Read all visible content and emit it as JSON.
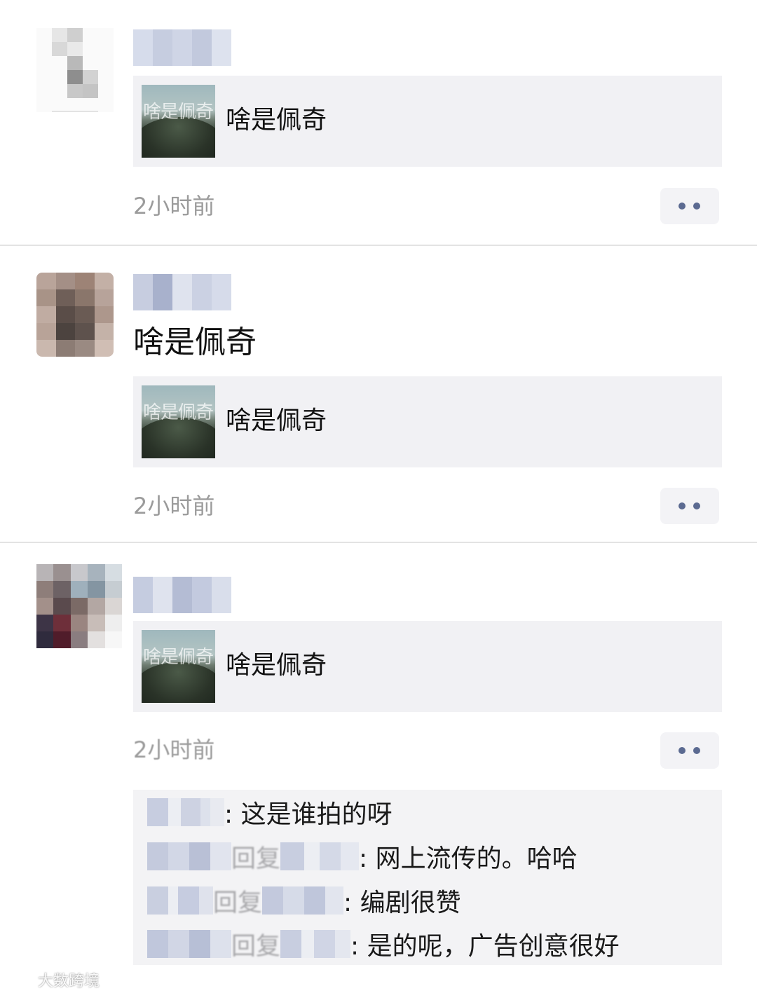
{
  "posts": [
    {
      "text": "",
      "share": {
        "title": "啥是佩奇",
        "thumb_text": "啥是佩奇"
      },
      "time": "2小时前"
    },
    {
      "text": "啥是佩奇",
      "share": {
        "title": "啥是佩奇",
        "thumb_text": "啥是佩奇"
      },
      "time": "2小时前"
    },
    {
      "text": "",
      "share": {
        "title": "啥是佩奇",
        "thumb_text": "啥是佩奇"
      },
      "time": "2小时前",
      "comments": [
        {
          "reply_word": "",
          "text": ": 这是谁拍的呀"
        },
        {
          "reply_word": "回复",
          "text": ": 网上流传的。哈哈"
        },
        {
          "reply_word": "回复",
          "text": ": 编剧很赞"
        },
        {
          "reply_word": "回复",
          "text": ": 是的呢，广告创意很好"
        }
      ]
    }
  ],
  "watermark": {
    "text": "大数跨境",
    "logo_icon": "brand-logo-icon"
  },
  "colors": {
    "link_dots": "#5b6a91",
    "timestamp": "#9b9b9b",
    "card_bg": "#f1f1f4",
    "comments_bg": "#f3f3f5"
  }
}
